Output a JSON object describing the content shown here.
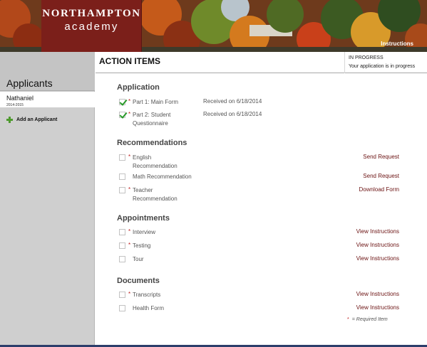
{
  "banner": {
    "logo_top": "NORTHAMPTON",
    "logo_bottom": "academy",
    "instructions_link": "Instructions",
    "colors": {
      "logo_bg": "#7b1f1a"
    }
  },
  "sidebar": {
    "heading": "Applicants",
    "applicant": {
      "name": "Nathaniel",
      "year": "2014-2015"
    },
    "add_label": "Add an Applicant"
  },
  "main": {
    "title": "ACTION ITEMS",
    "status": {
      "title": "IN PROGRESS",
      "text": "Your application is in progress"
    }
  },
  "sections": {
    "application": {
      "title": "Application",
      "items": [
        {
          "label": "Part 1: Main Form",
          "required": true,
          "checked": true,
          "received": "Received on 6/18/2014"
        },
        {
          "label_line1": "Part 2: Student",
          "label_line2": "Questionnaire",
          "required": true,
          "checked": true,
          "received": "Received on 6/18/2014"
        }
      ]
    },
    "recommendations": {
      "title": "Recommendations",
      "items": [
        {
          "label_line1": "English",
          "label_line2": "Recommendation",
          "required": true,
          "checked": false,
          "action": "Send Request"
        },
        {
          "label": "Math Recommendation",
          "required": false,
          "checked": false,
          "action": "Send Request"
        },
        {
          "label_line1": "Teacher",
          "label_line2": "Recommendation",
          "required": true,
          "checked": false,
          "action": "Download Form"
        }
      ]
    },
    "appointments": {
      "title": "Appointments",
      "items": [
        {
          "label": "Interview",
          "required": true,
          "checked": false,
          "action": "View Instructions"
        },
        {
          "label": "Testing",
          "required": true,
          "checked": false,
          "action": "View Instructions"
        },
        {
          "label": "Tour",
          "required": false,
          "checked": false,
          "action": "View Instructions"
        }
      ]
    },
    "documents": {
      "title": "Documents",
      "items": [
        {
          "label": "Transcripts",
          "required": true,
          "checked": false,
          "action": "View Instructions"
        },
        {
          "label": "Health Form",
          "required": false,
          "checked": false,
          "action": "View Instructions"
        }
      ]
    }
  },
  "legend": {
    "star": "*",
    "text": "= Required Item"
  },
  "required_marker": "*",
  "icons": {
    "check": "check-icon",
    "add": "plus-icon"
  },
  "colors": {
    "required": "#c02020",
    "action_link": "#6b1212",
    "check": "#2a9a2a",
    "add": "#4e9a2e"
  }
}
